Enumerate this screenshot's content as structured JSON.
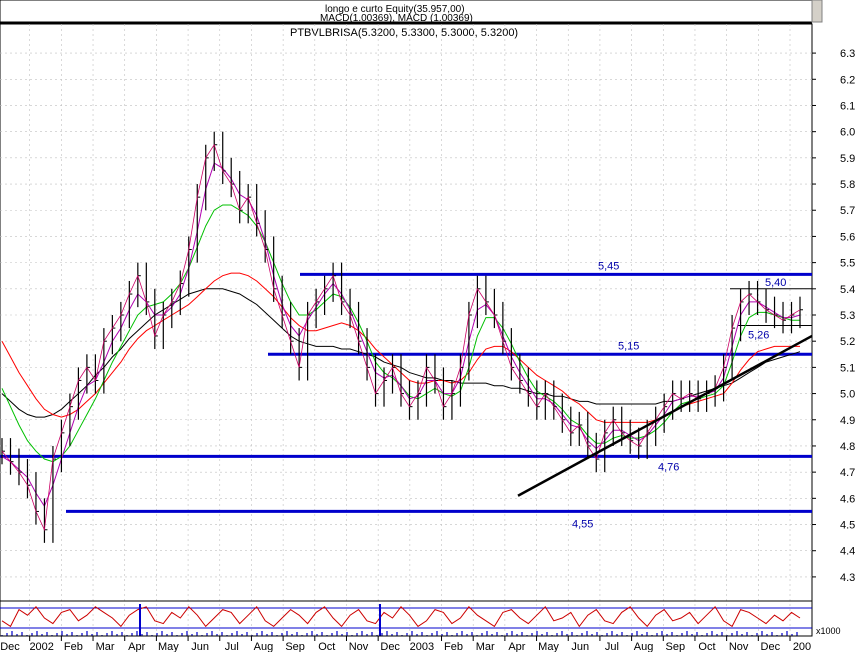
{
  "chart_data": {
    "type": "line",
    "indicator_header": "longo e curto Equity(35.957,00)",
    "macd_header": "MACD(1.00369), MACD (1.00369)",
    "title": "PTBVLBRISA(5.3200, 5.3300, 5.3000, 5.3200)",
    "y_ticks": [
      "6.3",
      "6.2",
      "6.1",
      "6.0",
      "5.9",
      "5.8",
      "5.7",
      "5.6",
      "5.5",
      "5.4",
      "5.3",
      "5.2",
      "5.1",
      "5.0",
      "4.9",
      "4.8",
      "4.7",
      "4.6",
      "4.5",
      "4.4",
      "4.3"
    ],
    "ylim": [
      4.25,
      6.35
    ],
    "x_ticks": [
      "Dec",
      "2002",
      "Feb",
      "Mar",
      "Apr",
      "May",
      "Jun",
      "Jul",
      "Aug",
      "Sep",
      "Oct",
      "Nov",
      "Dec",
      "2003",
      "Feb",
      "Mar",
      "Apr",
      "May",
      "Jun",
      "Jul",
      "Aug",
      "Sep",
      "Oct",
      "Nov",
      "Dec",
      "200"
    ],
    "volume_axis_label": "x1000",
    "levels": [
      {
        "label": "5,45",
        "value": 5.455
      },
      {
        "label": "5,15",
        "value": 5.15
      },
      {
        "label": "4,76",
        "value": 4.76
      },
      {
        "label": "4,55",
        "value": 4.55
      },
      {
        "label": "5,40",
        "value": 5.4
      },
      {
        "label": "5,26",
        "value": 5.26
      }
    ],
    "trendline": {
      "start": [
        "Apr 2003",
        4.61
      ],
      "end": [
        "Dec 2003+",
        5.22
      ]
    },
    "price_close": [
      4.78,
      4.74,
      4.7,
      4.65,
      4.55,
      4.48,
      4.75,
      4.85,
      4.95,
      5.05,
      5.1,
      5.05,
      5.2,
      5.25,
      5.3,
      5.38,
      5.45,
      5.35,
      5.22,
      5.3,
      5.35,
      5.42,
      5.55,
      5.75,
      5.9,
      5.95,
      5.85,
      5.8,
      5.7,
      5.75,
      5.65,
      5.55,
      5.4,
      5.3,
      5.2,
      5.1,
      5.3,
      5.35,
      5.4,
      5.45,
      5.35,
      5.3,
      5.2,
      5.1,
      5.0,
      5.05,
      5.1,
      5.0,
      4.95,
      5.0,
      5.1,
      5.05,
      4.95,
      5.0,
      5.1,
      5.3,
      5.4,
      5.35,
      5.3,
      5.2,
      5.1,
      5.05,
      5.0,
      4.95,
      5.0,
      4.95,
      4.9,
      4.85,
      4.88,
      4.8,
      4.75,
      4.85,
      4.9,
      4.85,
      4.82,
      4.8,
      4.85,
      4.9,
      4.95,
      5.0,
      4.98,
      5.0,
      4.98,
      5.0,
      5.02,
      5.1,
      5.25,
      5.35,
      5.38,
      5.35,
      5.32,
      5.3,
      5.28,
      5.3,
      5.32
    ],
    "ma_short": [
      4.76,
      4.74,
      4.71,
      4.68,
      4.62,
      4.57,
      4.65,
      4.75,
      4.85,
      4.95,
      5.03,
      5.05,
      5.12,
      5.2,
      5.25,
      5.32,
      5.38,
      5.35,
      5.3,
      5.3,
      5.33,
      5.38,
      5.48,
      5.62,
      5.78,
      5.88,
      5.86,
      5.82,
      5.76,
      5.74,
      5.68,
      5.58,
      5.45,
      5.34,
      5.26,
      5.22,
      5.28,
      5.33,
      5.38,
      5.42,
      5.38,
      5.32,
      5.24,
      5.16,
      5.08,
      5.06,
      5.07,
      5.03,
      4.98,
      4.99,
      5.05,
      5.05,
      5.0,
      5.0,
      5.06,
      5.2,
      5.32,
      5.34,
      5.3,
      5.22,
      5.14,
      5.08,
      5.03,
      4.98,
      4.98,
      4.96,
      4.92,
      4.88,
      4.87,
      4.82,
      4.79,
      4.82,
      4.86,
      4.86,
      4.84,
      4.82,
      4.84,
      4.88,
      4.92,
      4.97,
      4.98,
      4.99,
      4.99,
      5.0,
      5.01,
      5.06,
      5.18,
      5.3,
      5.35,
      5.35,
      5.33,
      5.31,
      5.29,
      5.29,
      5.3
    ],
    "ma_long": [
      5.02,
      4.95,
      4.88,
      4.82,
      4.78,
      4.75,
      4.74,
      4.76,
      4.8,
      4.86,
      4.92,
      4.98,
      5.05,
      5.12,
      5.18,
      5.24,
      5.3,
      5.33,
      5.34,
      5.35,
      5.38,
      5.42,
      5.48,
      5.56,
      5.64,
      5.7,
      5.72,
      5.72,
      5.7,
      5.68,
      5.64,
      5.58,
      5.5,
      5.42,
      5.35,
      5.3,
      5.3,
      5.32,
      5.35,
      5.38,
      5.37,
      5.33,
      5.27,
      5.2,
      5.12,
      5.08,
      5.06,
      5.03,
      4.99,
      4.98,
      5.0,
      5.02,
      5.0,
      4.99,
      5.01,
      5.1,
      5.22,
      5.29,
      5.29,
      5.25,
      5.19,
      5.12,
      5.06,
      5.01,
      4.99,
      4.97,
      4.94,
      4.9,
      4.88,
      4.84,
      4.81,
      4.81,
      4.83,
      4.84,
      4.83,
      4.83,
      4.84,
      4.86,
      4.89,
      4.93,
      4.96,
      4.97,
      4.98,
      4.99,
      5.0,
      5.03,
      5.12,
      5.22,
      5.29,
      5.31,
      5.31,
      5.3,
      5.29,
      5.28,
      5.28
    ],
    "ma_very_long": [
      5.2,
      5.14,
      5.08,
      5.03,
      4.98,
      4.94,
      4.92,
      4.91,
      4.92,
      4.94,
      4.97,
      5.0,
      5.04,
      5.08,
      5.12,
      5.17,
      5.21,
      5.24,
      5.26,
      5.28,
      5.3,
      5.32,
      5.34,
      5.37,
      5.4,
      5.43,
      5.45,
      5.46,
      5.46,
      5.45,
      5.43,
      5.4,
      5.37,
      5.33,
      5.29,
      5.26,
      5.24,
      5.24,
      5.25,
      5.26,
      5.27,
      5.26,
      5.24,
      5.21,
      5.17,
      5.14,
      5.11,
      5.08,
      5.05,
      5.04,
      5.04,
      5.05,
      5.05,
      5.04,
      5.05,
      5.08,
      5.13,
      5.17,
      5.18,
      5.18,
      5.16,
      5.13,
      5.1,
      5.07,
      5.05,
      5.03,
      5.01,
      4.98,
      4.96,
      4.93,
      4.9,
      4.89,
      4.89,
      4.89,
      4.89,
      4.89,
      4.89,
      4.9,
      4.91,
      4.93,
      4.95,
      4.96,
      4.97,
      4.98,
      4.99,
      5.0,
      5.04,
      5.09,
      5.13,
      5.16,
      5.17,
      5.18,
      5.18,
      5.18,
      5.18
    ],
    "ma_200": [
      5.0,
      4.97,
      4.94,
      4.92,
      4.91,
      4.91,
      4.92,
      4.94,
      4.97,
      5.0,
      5.03,
      5.07,
      5.1,
      5.14,
      5.17,
      5.21,
      5.24,
      5.27,
      5.3,
      5.32,
      5.34,
      5.36,
      5.38,
      5.39,
      5.4,
      5.4,
      5.4,
      5.39,
      5.38,
      5.36,
      5.34,
      5.31,
      5.28,
      5.25,
      5.22,
      5.2,
      5.19,
      5.18,
      5.18,
      5.18,
      5.17,
      5.17,
      5.16,
      5.15,
      5.14,
      5.12,
      5.11,
      5.1,
      5.08,
      5.07,
      5.06,
      5.06,
      5.05,
      5.05,
      5.04,
      5.04,
      5.04,
      5.04,
      5.03,
      5.03,
      5.02,
      5.02,
      5.01,
      5.0,
      5.0,
      4.99,
      4.99,
      4.98,
      4.97,
      4.97,
      4.96,
      4.96,
      4.96,
      4.96,
      4.96,
      4.96,
      4.96,
      4.96,
      4.97,
      4.97,
      4.98,
      4.99,
      5.0,
      5.01,
      5.02,
      5.03,
      5.04,
      5.06,
      5.08,
      5.1,
      5.12,
      5.13,
      5.14,
      5.15,
      5.16
    ],
    "stoch_k": [
      0.4,
      0.2,
      0.8,
      0.6,
      0.9,
      0.5,
      0.3,
      0.7,
      0.8,
      0.4,
      0.6,
      0.9,
      0.7,
      0.5,
      0.2,
      0.6,
      0.8,
      0.9,
      0.4,
      0.3,
      0.7,
      0.5,
      0.9,
      0.6,
      0.2,
      0.5,
      0.8,
      0.7,
      0.3,
      0.6,
      0.9,
      0.4,
      0.2,
      0.5,
      0.8,
      0.6,
      0.3,
      0.7,
      0.9,
      0.5,
      0.2,
      0.6,
      0.8,
      0.4,
      0.3,
      0.7,
      0.5,
      0.9,
      0.6,
      0.2,
      0.4,
      0.8,
      0.7,
      0.3,
      0.5,
      0.9,
      0.6,
      0.4,
      0.2,
      0.7,
      0.8,
      0.5,
      0.3,
      0.6,
      0.9,
      0.4,
      0.5,
      0.7,
      0.2,
      0.6,
      0.8,
      0.4,
      0.3,
      0.7,
      0.9,
      0.5,
      0.2,
      0.6,
      0.8,
      0.4,
      0.5,
      0.7,
      0.3,
      0.6,
      0.9,
      0.4,
      0.2,
      0.8,
      0.7,
      0.5,
      0.3,
      0.6,
      0.4,
      0.7,
      0.5
    ],
    "colors": {
      "grid": "#c0c0c0",
      "price": "#000000",
      "price_highlight": "#cc0066",
      "ma_short": "#b000b0",
      "ma_long": "#00c000",
      "ma_very_long": "#ff0000",
      "ma_200": "#000000",
      "levels": "#0000cc",
      "level_label": "#0000aa",
      "stoch": "#cc0000",
      "stoch_band": "#0000cc",
      "volume": "#0000cc"
    }
  }
}
